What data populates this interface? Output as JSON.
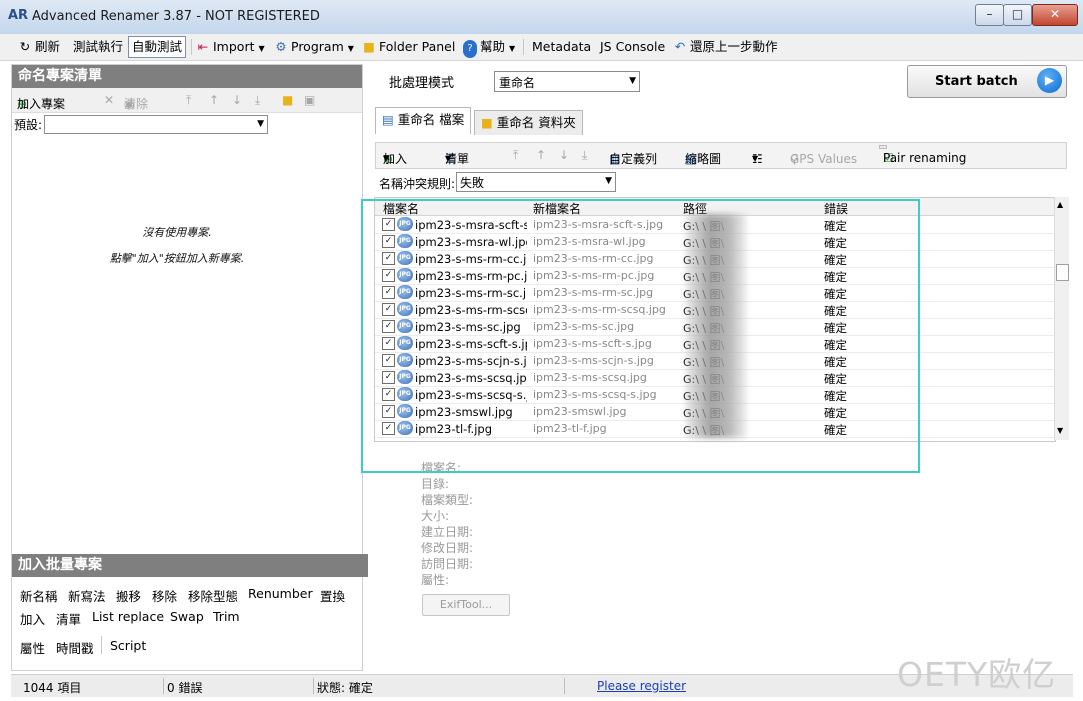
{
  "window": {
    "title": "Advanced Renamer 3.87 - NOT REGISTERED",
    "controls": {
      "minimize": "–",
      "maximize": "□",
      "close": "✕"
    }
  },
  "toolbar": {
    "refresh": "刷新",
    "test_run": "測試執行",
    "auto_test": "自動測試",
    "import": "Import",
    "program": "Program",
    "folder_panel": "Folder Panel",
    "help": "幫助",
    "metadata": "Metadata",
    "js_console": "JS Console",
    "undo": "還原上一步動作"
  },
  "left": {
    "header": "命名專案清單",
    "add_method": "加入專案",
    "clear": "清除",
    "preset_label": "預設:",
    "empty_line1": "沒有使用專案.",
    "empty_line2": "點擊\"加入\"按鈕加入新專案.",
    "batch_header": "加入批量專案",
    "batch_row1": [
      "新名稱",
      "新寫法",
      "搬移",
      "移除",
      "移除型態",
      "Renumber",
      "置換"
    ],
    "batch_row2": [
      "加入",
      "清單",
      "List replace",
      "Swap",
      "Trim"
    ],
    "batch_row3": [
      "屬性",
      "時間戳",
      "Script"
    ]
  },
  "right": {
    "mode_label": "批處理模式",
    "mode_value": "重命名",
    "start_batch": "Start batch",
    "tab_files": "重命名 檔案",
    "tab_folders": "重命名 資料夾",
    "tb_add": "加入",
    "tb_clear": "清單",
    "tb_columns": "自定義列",
    "tb_thumbnails": "縮略圖",
    "tb_gps": "GPS Values",
    "tb_pair": "Pair renaming",
    "conflict_label": "名稱沖突規則:",
    "conflict_value": "失敗",
    "columns": [
      "檔案名",
      "新檔案名",
      "路徑",
      "錯誤"
    ],
    "rows": [
      {
        "name": "ipm23-s-msra-scft-s...",
        "new": "ipm23-s-msra-scft-s.jpg",
        "path": "G:\\    \\    图\\",
        "err": "確定"
      },
      {
        "name": "ipm23-s-msra-wl.jpg",
        "new": "ipm23-s-msra-wl.jpg",
        "path": "G:\\    \\    图\\",
        "err": "確定"
      },
      {
        "name": "ipm23-s-ms-rm-cc.jpg",
        "new": "ipm23-s-ms-rm-cc.jpg",
        "path": "G:\\    \\    图\\",
        "err": "確定"
      },
      {
        "name": "ipm23-s-ms-rm-pc.jpg",
        "new": "ipm23-s-ms-rm-pc.jpg",
        "path": "G:\\    \\    图\\",
        "err": "確定"
      },
      {
        "name": "ipm23-s-ms-rm-sc.jpg",
        "new": "ipm23-s-ms-rm-sc.jpg",
        "path": "G:\\    \\    图\\",
        "err": "確定"
      },
      {
        "name": "ipm23-s-ms-rm-scsq...",
        "new": "ipm23-s-ms-rm-scsq.jpg",
        "path": "G:\\    \\    图\\",
        "err": "確定"
      },
      {
        "name": "ipm23-s-ms-sc.jpg",
        "new": "ipm23-s-ms-sc.jpg",
        "path": "G:\\    \\    图\\",
        "err": "確定"
      },
      {
        "name": "ipm23-s-ms-scft-s.jpg",
        "new": "ipm23-s-ms-scft-s.jpg",
        "path": "G:\\    \\    图\\",
        "err": "確定"
      },
      {
        "name": "ipm23-s-ms-scjn-s.jpg",
        "new": "ipm23-s-ms-scjn-s.jpg",
        "path": "G:\\    \\    图\\",
        "err": "確定"
      },
      {
        "name": "ipm23-s-ms-scsq.jpg",
        "new": "ipm23-s-ms-scsq.jpg",
        "path": "G:\\    \\    图\\",
        "err": "確定"
      },
      {
        "name": "ipm23-s-ms-scsq-s.jpg",
        "new": "ipm23-s-ms-scsq-s.jpg",
        "path": "G:\\    \\    图\\",
        "err": "確定"
      },
      {
        "name": "ipm23-smswl.jpg",
        "new": "ipm23-smswl.jpg",
        "path": "G:\\    \\    图\\",
        "err": "確定"
      },
      {
        "name": "ipm23-tl-f.jpg",
        "new": "ipm23-tl-f.jpg",
        "path": "G:\\    \\    图\\",
        "err": "確定"
      }
    ],
    "props": [
      "檔案名:",
      "目錄:",
      "檔案類型:",
      "大小:",
      "建立日期:",
      "修改日期:",
      "訪問日期:",
      "屬性:"
    ],
    "exiftool": "ExifTool..."
  },
  "status": {
    "items_count": "1044 項目",
    "errors": "0 錯誤",
    "state": "狀態: 確定",
    "register": "Please register"
  },
  "watermark": "OETY欧亿",
  "colors": {
    "highlight": "#3fcbc6",
    "header": "#7f7f7f",
    "link": "#1a3cc2"
  }
}
